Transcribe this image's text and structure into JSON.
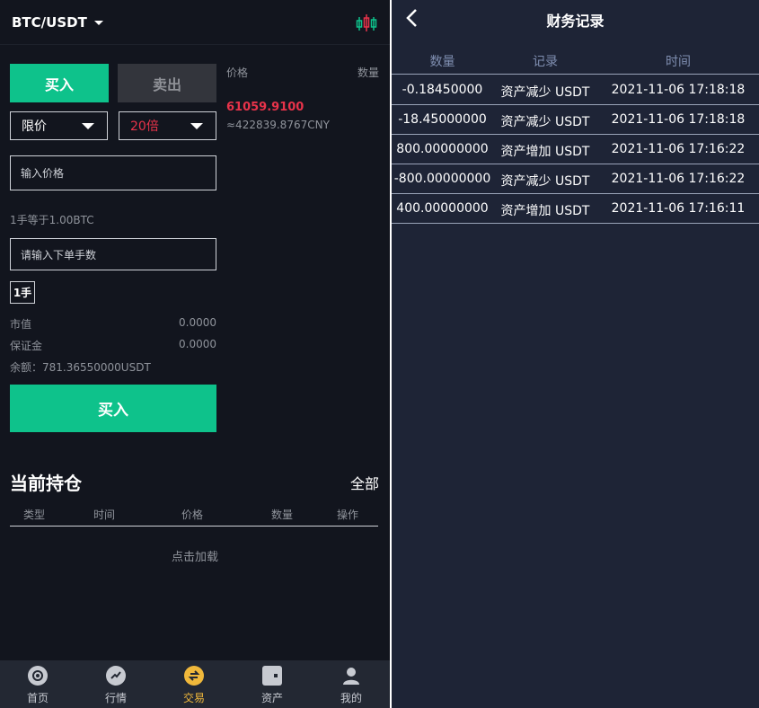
{
  "trade": {
    "pair": "BTC/USDT",
    "tabs": {
      "buy": "买入",
      "sell": "卖出"
    },
    "order_type": "限价",
    "leverage": "20倍",
    "orderbook": {
      "price_header": "价格",
      "qty_header": "数量"
    },
    "last_price": "61059.9100",
    "last_price_cny": "≈422839.8767CNY",
    "price_placeholder": "输入价格",
    "lot_note": "1手等于1.00BTC",
    "lots_placeholder": "请输入下单手数",
    "lot_chip": "1手",
    "market_value": {
      "label": "市值",
      "value": "0.0000"
    },
    "margin": {
      "label": "保证金",
      "value": "0.0000"
    },
    "balance": "余额：781.36550000USDT",
    "submit": "买入"
  },
  "positions": {
    "title": "当前持仓",
    "all": "全部",
    "columns": [
      "类型",
      "时间",
      "价格",
      "数量",
      "操作"
    ],
    "load_more": "点击加载"
  },
  "tabbar": {
    "items": [
      {
        "label": "首页",
        "icon": "home-icon"
      },
      {
        "label": "行情",
        "icon": "market-icon"
      },
      {
        "label": "交易",
        "icon": "trade-icon"
      },
      {
        "label": "资产",
        "icon": "wallet-icon"
      },
      {
        "label": "我的",
        "icon": "user-icon"
      }
    ],
    "active": "交易"
  },
  "records": {
    "title": "财务记录",
    "columns": [
      "数量",
      "记录",
      "时间"
    ],
    "rows": [
      {
        "amount": "-0.18450000",
        "type": "资产减少 USDT",
        "time": "2021-11-06 17:18:18"
      },
      {
        "amount": "-18.45000000",
        "type": "资产减少 USDT",
        "time": "2021-11-06 17:18:18"
      },
      {
        "amount": "800.00000000",
        "type": "资产增加 USDT",
        "time": "2021-11-06 17:16:22"
      },
      {
        "amount": "-800.00000000",
        "type": "资产减少 USDT",
        "time": "2021-11-06 17:16:22"
      },
      {
        "amount": "400.00000000",
        "type": "资产增加 USDT",
        "time": "2021-11-06 17:16:11"
      }
    ]
  },
  "colors": {
    "buy_green": "#0ec28b",
    "price_red": "#e8334a",
    "active_tab": "#f0b83b",
    "left_bg": "#12151e",
    "right_bg": "#1e2436"
  }
}
